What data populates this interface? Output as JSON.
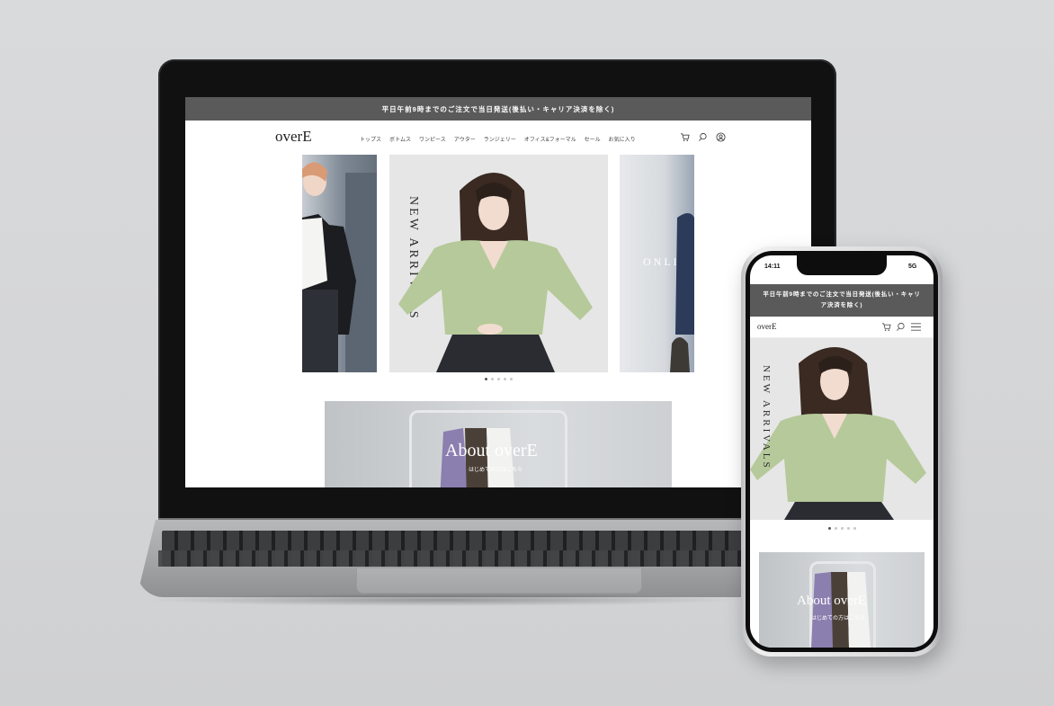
{
  "desktop": {
    "announcement": "平日午前9時までのご注文で当日発送(後払い・キャリア決済を除く)",
    "logo": "overE",
    "nav": [
      "トップス",
      "ボトムス",
      "ワンピース",
      "アウター",
      "ランジェリー",
      "オフィス&フォーマル",
      "セール",
      "お気に入り"
    ],
    "icons": [
      "cart-icon",
      "search-icon",
      "account-icon"
    ],
    "hero_title": "NEW ARRIVALS",
    "right_slide_text": "ONLINE",
    "slider_dots": 5,
    "slider_active": 0,
    "about_title": "About overE",
    "about_subtitle": "はじめての方はこちら"
  },
  "phone": {
    "time": "14:11",
    "signal": "5G",
    "announcement": "平日午前9時までのご注文で当日発送(後払い・キャリア決済を除く)",
    "logo": "overE",
    "icons": [
      "cart-icon",
      "search-icon",
      "menu-icon"
    ],
    "hero_title": "NEW ARRIVALS",
    "slider_dots": 5,
    "slider_active": 0,
    "about_title": "About overE",
    "about_subtitle": "はじめての方はこちら"
  },
  "colors": {
    "announcement_bg": "#5a5a5a",
    "sweater": "#b6c99a",
    "skirt": "#2a2c32",
    "background": "#d6d7d9"
  }
}
